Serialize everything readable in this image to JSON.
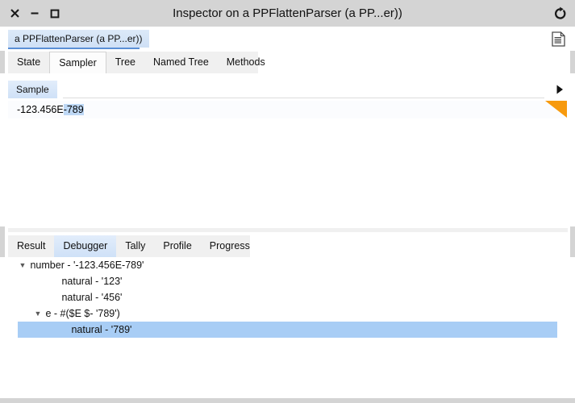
{
  "window": {
    "title": "Inspector on a PPFlattenParser (a PP...er))",
    "controls": {
      "close_label": "✕",
      "minimize_label": "–",
      "maximize_label": "□"
    },
    "refresh_icon": "refresh-icon",
    "colors": {
      "titlebar_bg": "#d4d4d4",
      "selection_blue": "#a8cdf5",
      "tab_blue": "#cfe1f7",
      "accent_orange": "#f79a0e",
      "tabstrip_bg": "#f0f0f0",
      "breadcrumb_underline": "#5a8fd6"
    }
  },
  "breadcrumb": {
    "label": "a PPFlattenParser (a PP...er))",
    "doc_icon": "document-icon"
  },
  "top_tabs": {
    "items": [
      {
        "label": "State",
        "selected": false
      },
      {
        "label": "Sampler",
        "selected": true
      },
      {
        "label": "Tree",
        "selected": false
      },
      {
        "label": "Named Tree",
        "selected": false
      },
      {
        "label": "Methods",
        "selected": false
      }
    ]
  },
  "sample_pane": {
    "tab_label": "Sample",
    "expand_icon": "play-triangle-icon",
    "text_prefix": "-123.456E",
    "text_selected": "-789",
    "full_text": "-123.456E-789"
  },
  "bottom_tabs": {
    "items": [
      {
        "label": "Result",
        "selected": false
      },
      {
        "label": "Debugger",
        "selected": true
      },
      {
        "label": "Tally",
        "selected": false
      },
      {
        "label": "Profile",
        "selected": false
      },
      {
        "label": "Progress",
        "selected": false
      }
    ]
  },
  "tree": {
    "rows": [
      {
        "label": "number - '-123.456E-789'",
        "twisty": "▼",
        "indent": 0,
        "selected": false
      },
      {
        "label": "natural - '123'",
        "twisty": "",
        "indent": 1,
        "selected": false
      },
      {
        "label": "natural - '456'",
        "twisty": "",
        "indent": 1,
        "selected": false
      },
      {
        "label": "e - #($E $- '789')",
        "twisty": "▼",
        "indent": 2,
        "selected": false
      },
      {
        "label": "natural - '789'",
        "twisty": "",
        "indent": 3,
        "selected": true
      }
    ]
  }
}
